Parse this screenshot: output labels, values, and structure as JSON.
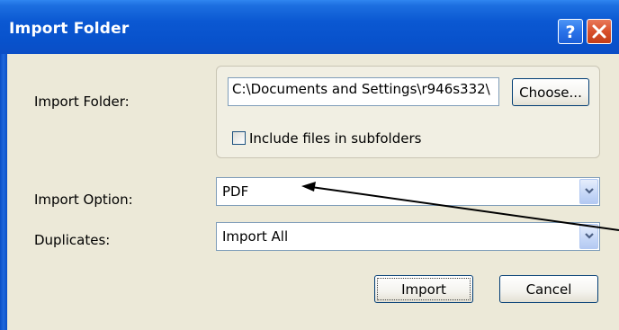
{
  "window": {
    "title": "Import Folder",
    "help_glyph": "?",
    "close_glyph": "x",
    "titlebar_color": "#0a4ec6"
  },
  "import_folder": {
    "label": "Import Folder:",
    "path_value": "C:\\Documents and Settings\\r946s332\\",
    "choose_label": "Choose..."
  },
  "subfolders": {
    "label": "Include files in subfolders",
    "checked": false
  },
  "import_option": {
    "label": "Import Option:",
    "selected": "PDF"
  },
  "duplicates": {
    "label": "Duplicates:",
    "selected": "Import All"
  },
  "actions": {
    "import_label": "Import",
    "cancel_label": "Cancel"
  },
  "icons": [
    "help-icon",
    "close-icon",
    "chevron-down-icon",
    "annotation-arrow"
  ]
}
